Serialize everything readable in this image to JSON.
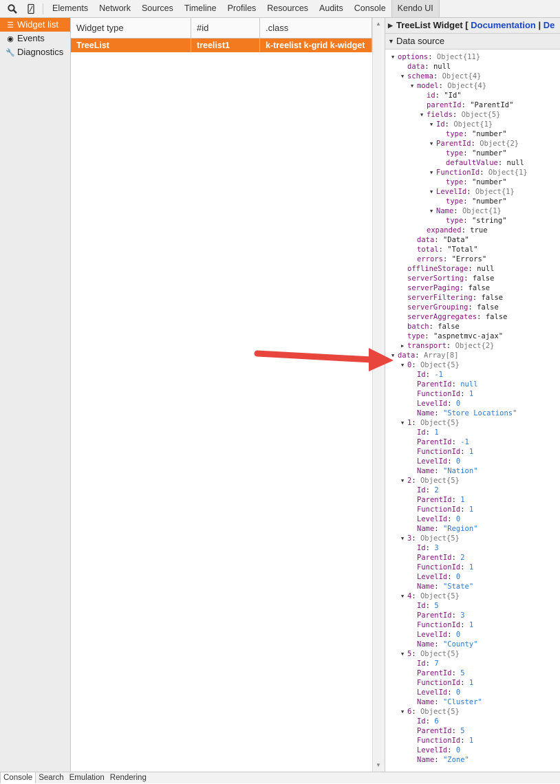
{
  "toolbar": {
    "tabs": [
      "Elements",
      "Network",
      "Sources",
      "Timeline",
      "Profiles",
      "Resources",
      "Audits",
      "Console",
      "Kendo UI"
    ],
    "active_tab": "Kendo UI"
  },
  "leftnav": {
    "items": [
      {
        "label": "Widget list",
        "icon": "list-icon"
      },
      {
        "label": "Events",
        "icon": "eye-icon"
      },
      {
        "label": "Diagnostics",
        "icon": "wrench-icon"
      }
    ]
  },
  "table": {
    "headers": [
      "Widget type",
      "#id",
      ".class"
    ],
    "rows": [
      [
        "TreeList",
        "treelist1",
        "k-treelist k-grid k-widget"
      ]
    ]
  },
  "rightpane": {
    "widget_title": "TreeList Widget [",
    "doc_link": "Documentation",
    "separator": "|",
    "more_link": "De",
    "datasource_title": "Data source"
  },
  "tree": [
    {
      "indent": 0,
      "arrow": "down",
      "key": "options",
      "sep": ": ",
      "val": "Object{11}",
      "vc": "dim"
    },
    {
      "indent": 1,
      "key": "data",
      "sep": ": ",
      "val": "null",
      "vc": "kw"
    },
    {
      "indent": 1,
      "arrow": "down",
      "key": "schema",
      "sep": ": ",
      "val": "Object{4}",
      "vc": "dim"
    },
    {
      "indent": 2,
      "arrow": "down",
      "key": "model",
      "sep": ": ",
      "val": "Object{4}",
      "vc": "dim"
    },
    {
      "indent": 3,
      "key": "id",
      "sep": ": ",
      "val": "\"Id\"",
      "vc": "kw"
    },
    {
      "indent": 3,
      "key": "parentId",
      "sep": ": ",
      "val": "\"ParentId\"",
      "vc": "kw"
    },
    {
      "indent": 3,
      "arrow": "down",
      "key": "fields",
      "sep": ": ",
      "val": "Object{5}",
      "vc": "dim"
    },
    {
      "indent": 4,
      "arrow": "down",
      "key": "Id",
      "sep": ": ",
      "val": "Object{1}",
      "vc": "dim"
    },
    {
      "indent": 5,
      "key": "type",
      "sep": ": ",
      "val": "\"number\"",
      "vc": "kw"
    },
    {
      "indent": 4,
      "arrow": "down",
      "key": "ParentId",
      "sep": ": ",
      "val": "Object{2}",
      "vc": "dim"
    },
    {
      "indent": 5,
      "key": "type",
      "sep": ": ",
      "val": "\"number\"",
      "vc": "kw"
    },
    {
      "indent": 5,
      "key": "defaultValue",
      "sep": ": ",
      "val": "null",
      "vc": "kw"
    },
    {
      "indent": 4,
      "arrow": "down",
      "key": "FunctionId",
      "sep": ": ",
      "val": "Object{1}",
      "vc": "dim"
    },
    {
      "indent": 5,
      "key": "type",
      "sep": ": ",
      "val": "\"number\"",
      "vc": "kw"
    },
    {
      "indent": 4,
      "arrow": "down",
      "key": "LevelId",
      "sep": ": ",
      "val": "Object{1}",
      "vc": "dim"
    },
    {
      "indent": 5,
      "key": "type",
      "sep": ": ",
      "val": "\"number\"",
      "vc": "kw"
    },
    {
      "indent": 4,
      "arrow": "down",
      "key": "Name",
      "sep": ": ",
      "val": "Object{1}",
      "vc": "dim"
    },
    {
      "indent": 5,
      "key": "type",
      "sep": ": ",
      "val": "\"string\"",
      "vc": "kw"
    },
    {
      "indent": 3,
      "key": "expanded",
      "sep": ": ",
      "val": "true",
      "vc": "kw"
    },
    {
      "indent": 2,
      "key": "data",
      "sep": ": ",
      "val": "\"Data\"",
      "vc": "kw"
    },
    {
      "indent": 2,
      "key": "total",
      "sep": ": ",
      "val": "\"Total\"",
      "vc": "kw"
    },
    {
      "indent": 2,
      "key": "errors",
      "sep": ": ",
      "val": "\"Errors\"",
      "vc": "kw"
    },
    {
      "indent": 1,
      "key": "offlineStorage",
      "sep": ": ",
      "val": "null",
      "vc": "kw"
    },
    {
      "indent": 1,
      "key": "serverSorting",
      "sep": ": ",
      "val": "false",
      "vc": "kw"
    },
    {
      "indent": 1,
      "key": "serverPaging",
      "sep": ": ",
      "val": "false",
      "vc": "kw"
    },
    {
      "indent": 1,
      "key": "serverFiltering",
      "sep": ": ",
      "val": "false",
      "vc": "kw"
    },
    {
      "indent": 1,
      "key": "serverGrouping",
      "sep": ": ",
      "val": "false",
      "vc": "kw"
    },
    {
      "indent": 1,
      "key": "serverAggregates",
      "sep": ": ",
      "val": "false",
      "vc": "kw"
    },
    {
      "indent": 1,
      "key": "batch",
      "sep": ": ",
      "val": "false",
      "vc": "kw"
    },
    {
      "indent": 1,
      "key": "type",
      "sep": ": ",
      "val": "\"aspnetmvc-ajax\"",
      "vc": "kw"
    },
    {
      "indent": 1,
      "arrow": "right",
      "key": "transport",
      "sep": ": ",
      "val": "Object{2}",
      "vc": "dim"
    },
    {
      "indent": 0,
      "arrow": "down",
      "key": "data",
      "sep": ": ",
      "val": "Array[8]",
      "vc": "dim"
    },
    {
      "indent": 1,
      "arrow": "down",
      "key": "0",
      "sep": ": ",
      "val": "Object{5}",
      "vc": "dim"
    },
    {
      "indent": 2,
      "key": "Id",
      "sep": ": ",
      "val": "-1",
      "vc": "blue"
    },
    {
      "indent": 2,
      "key": "ParentId",
      "sep": ": ",
      "val": "null",
      "vc": "blue"
    },
    {
      "indent": 2,
      "key": "FunctionId",
      "sep": ": ",
      "val": "1",
      "vc": "blue"
    },
    {
      "indent": 2,
      "key": "LevelId",
      "sep": ": ",
      "val": "0",
      "vc": "blue"
    },
    {
      "indent": 2,
      "key": "Name",
      "sep": ": ",
      "val": "\"Store Locations\"",
      "vc": "blue"
    },
    {
      "indent": 1,
      "arrow": "down",
      "key": "1",
      "sep": ": ",
      "val": "Object{5}",
      "vc": "dim"
    },
    {
      "indent": 2,
      "key": "Id",
      "sep": ": ",
      "val": "1",
      "vc": "blue"
    },
    {
      "indent": 2,
      "key": "ParentId",
      "sep": ": ",
      "val": "-1",
      "vc": "blue"
    },
    {
      "indent": 2,
      "key": "FunctionId",
      "sep": ": ",
      "val": "1",
      "vc": "blue"
    },
    {
      "indent": 2,
      "key": "LevelId",
      "sep": ": ",
      "val": "0",
      "vc": "blue"
    },
    {
      "indent": 2,
      "key": "Name",
      "sep": ": ",
      "val": "\"Nation\"",
      "vc": "blue"
    },
    {
      "indent": 1,
      "arrow": "down",
      "key": "2",
      "sep": ": ",
      "val": "Object{5}",
      "vc": "dim"
    },
    {
      "indent": 2,
      "key": "Id",
      "sep": ": ",
      "val": "2",
      "vc": "blue"
    },
    {
      "indent": 2,
      "key": "ParentId",
      "sep": ": ",
      "val": "1",
      "vc": "blue"
    },
    {
      "indent": 2,
      "key": "FunctionId",
      "sep": ": ",
      "val": "1",
      "vc": "blue"
    },
    {
      "indent": 2,
      "key": "LevelId",
      "sep": ": ",
      "val": "0",
      "vc": "blue"
    },
    {
      "indent": 2,
      "key": "Name",
      "sep": ": ",
      "val": "\"Region\"",
      "vc": "blue"
    },
    {
      "indent": 1,
      "arrow": "down",
      "key": "3",
      "sep": ": ",
      "val": "Object{5}",
      "vc": "dim"
    },
    {
      "indent": 2,
      "key": "Id",
      "sep": ": ",
      "val": "3",
      "vc": "blue"
    },
    {
      "indent": 2,
      "key": "ParentId",
      "sep": ": ",
      "val": "2",
      "vc": "blue"
    },
    {
      "indent": 2,
      "key": "FunctionId",
      "sep": ": ",
      "val": "1",
      "vc": "blue"
    },
    {
      "indent": 2,
      "key": "LevelId",
      "sep": ": ",
      "val": "0",
      "vc": "blue"
    },
    {
      "indent": 2,
      "key": "Name",
      "sep": ": ",
      "val": "\"State\"",
      "vc": "blue"
    },
    {
      "indent": 1,
      "arrow": "down",
      "key": "4",
      "sep": ": ",
      "val": "Object{5}",
      "vc": "dim"
    },
    {
      "indent": 2,
      "key": "Id",
      "sep": ": ",
      "val": "5",
      "vc": "blue"
    },
    {
      "indent": 2,
      "key": "ParentId",
      "sep": ": ",
      "val": "3",
      "vc": "blue"
    },
    {
      "indent": 2,
      "key": "FunctionId",
      "sep": ": ",
      "val": "1",
      "vc": "blue"
    },
    {
      "indent": 2,
      "key": "LevelId",
      "sep": ": ",
      "val": "0",
      "vc": "blue"
    },
    {
      "indent": 2,
      "key": "Name",
      "sep": ": ",
      "val": "\"County\"",
      "vc": "blue"
    },
    {
      "indent": 1,
      "arrow": "down",
      "key": "5",
      "sep": ": ",
      "val": "Object{5}",
      "vc": "dim"
    },
    {
      "indent": 2,
      "key": "Id",
      "sep": ": ",
      "val": "7",
      "vc": "blue"
    },
    {
      "indent": 2,
      "key": "ParentId",
      "sep": ": ",
      "val": "5",
      "vc": "blue"
    },
    {
      "indent": 2,
      "key": "FunctionId",
      "sep": ": ",
      "val": "1",
      "vc": "blue"
    },
    {
      "indent": 2,
      "key": "LevelId",
      "sep": ": ",
      "val": "0",
      "vc": "blue"
    },
    {
      "indent": 2,
      "key": "Name",
      "sep": ": ",
      "val": "\"Cluster\"",
      "vc": "blue"
    },
    {
      "indent": 1,
      "arrow": "down",
      "key": "6",
      "sep": ": ",
      "val": "Object{5}",
      "vc": "dim"
    },
    {
      "indent": 2,
      "key": "Id",
      "sep": ": ",
      "val": "6",
      "vc": "blue"
    },
    {
      "indent": 2,
      "key": "ParentId",
      "sep": ": ",
      "val": "5",
      "vc": "blue"
    },
    {
      "indent": 2,
      "key": "FunctionId",
      "sep": ": ",
      "val": "1",
      "vc": "blue"
    },
    {
      "indent": 2,
      "key": "LevelId",
      "sep": ": ",
      "val": "0",
      "vc": "blue"
    },
    {
      "indent": 2,
      "key": "Name",
      "sep": ": ",
      "val": "\"Zone\"",
      "vc": "blue"
    }
  ],
  "drawer": {
    "tabs": [
      "Console",
      "Search",
      "Emulation",
      "Rendering"
    ]
  },
  "colors": {
    "accent": "#f47a20",
    "annotation_arrow": "#e8453c",
    "link": "#1a47c8"
  }
}
